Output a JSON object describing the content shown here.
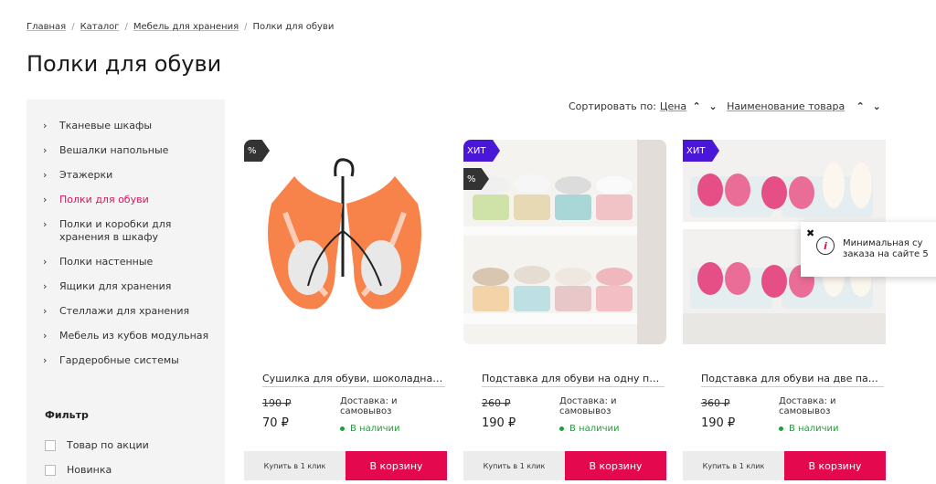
{
  "breadcrumb": [
    {
      "label": "Главная",
      "link": true
    },
    {
      "label": "Каталог",
      "link": true
    },
    {
      "label": "Мебель для хранения",
      "link": true
    },
    {
      "label": "Полки для обуви",
      "link": false
    }
  ],
  "breadcrumb_separator": "/",
  "page_title": "Полки для обуви",
  "sort": {
    "label": "Сортировать по:",
    "price": "Цена",
    "name": "Наименование товара"
  },
  "sidebar": {
    "items": [
      {
        "label": "Тканевые шкафы",
        "active": false
      },
      {
        "label": "Вешалки напольные",
        "active": false
      },
      {
        "label": "Этажерки",
        "active": false
      },
      {
        "label": "Полки для обуви",
        "active": true
      },
      {
        "label": "Полки и коробки для хранения в шкафу",
        "active": false
      },
      {
        "label": "Полки настенные",
        "active": false
      },
      {
        "label": "Ящики для хранения",
        "active": false
      },
      {
        "label": "Стеллажи для хранения",
        "active": false
      },
      {
        "label": "Мебель из кубов модульная",
        "active": false
      },
      {
        "label": "Гардеробные системы",
        "active": false
      }
    ],
    "filter_title": "Фильтр",
    "filters": [
      "Товар по акции",
      "Новинка"
    ]
  },
  "products": [
    {
      "name": "Сушилка для обуви, шоколадная, ...",
      "old_price": "190 ₽",
      "price": "70 ₽",
      "delivery": "Доставка: и самовывоз",
      "stock": "В наличии",
      "badges": [
        "%"
      ],
      "btn_1click": "Купить в 1 клик",
      "btn_cart": "В корзину"
    },
    {
      "name": "Подставка для обуви на одну пар...",
      "old_price": "260 ₽",
      "price": "190 ₽",
      "delivery": "Доставка: и самовывоз",
      "stock": "В наличии",
      "badges": [
        "ХИТ",
        "%"
      ],
      "btn_1click": "Купить в 1 клик",
      "btn_cart": "В корзину"
    },
    {
      "name": "Подставка для обуви на две пары...",
      "old_price": "360 ₽",
      "price": "190 ₽",
      "delivery": "Доставка: и самовывоз",
      "stock": "В наличии",
      "badges": [
        "ХИТ"
      ],
      "btn_1click": "Купить в 1 клик",
      "btn_cart": "В корзину"
    }
  ],
  "tooltip": {
    "close": "✖",
    "icon": "info-icon",
    "line1": "Минимальная су",
    "line2": "заказа на сайте 5"
  },
  "colors": {
    "accent": "#e4084f",
    "active_link": "#d8175e",
    "hit_badge": "#4a16d8",
    "stock": "#1e9e3a"
  }
}
